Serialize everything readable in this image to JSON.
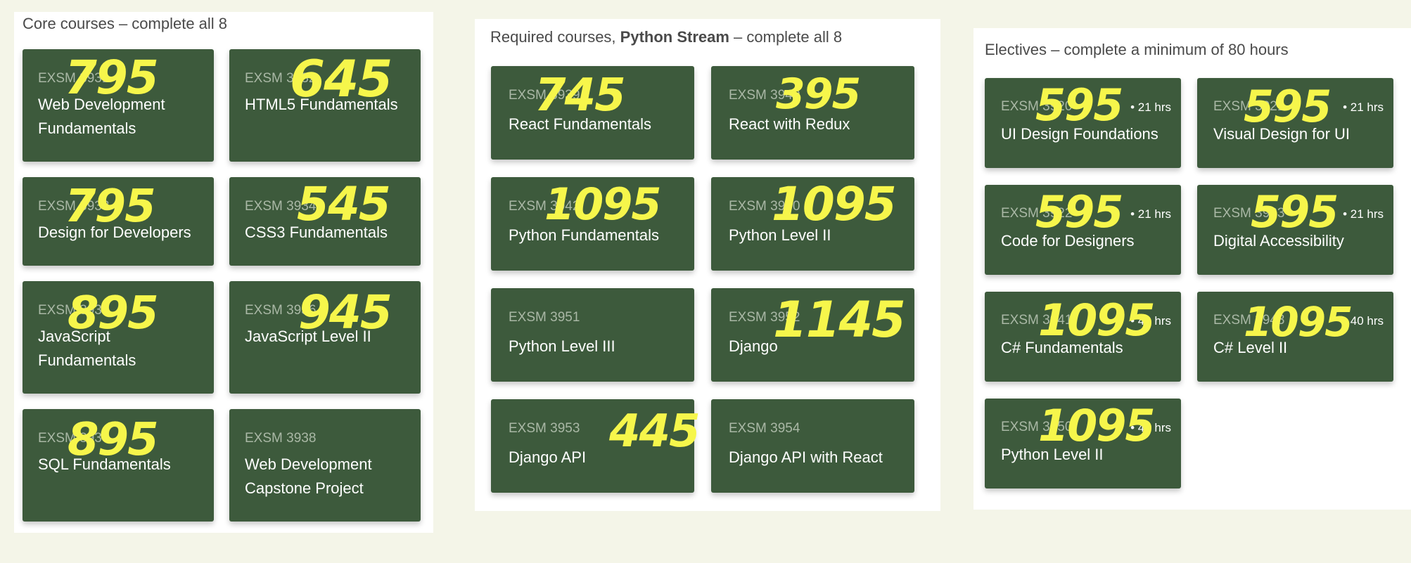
{
  "core": {
    "title": "Core courses – complete all 8",
    "courses": [
      {
        "code": "EXSM 3931",
        "name": "Web Development Fundamentals",
        "price": "795"
      },
      {
        "code": "EXSM 3932",
        "name": "HTML5 Fundamentals",
        "price": "645"
      },
      {
        "code": "EXSM 3933",
        "name": "Design for Developers",
        "price": "795"
      },
      {
        "code": "EXSM 3934",
        "name": "CSS3 Fundamentals",
        "price": "545"
      },
      {
        "code": "EXSM 3935",
        "name": "JavaScript Fundamentals",
        "price": "895"
      },
      {
        "code": "EXSM 3936",
        "name": "JavaScript Level II",
        "price": "945"
      },
      {
        "code": "EXSM 3937",
        "name": "SQL Fundamentals",
        "price": "895"
      },
      {
        "code": "EXSM 3938",
        "name": "Web Development Capstone Project",
        "price": ""
      }
    ]
  },
  "python": {
    "title_prefix": "Required courses, ",
    "title_bold": "Python Stream",
    "title_suffix": " – complete all 8",
    "courses": [
      {
        "code": "EXSM 3939",
        "name": "React Fundamentals",
        "price": "745"
      },
      {
        "code": "EXSM 3940",
        "name": "React with Redux",
        "price": "395"
      },
      {
        "code": "EXSM 3942",
        "name": "Python Fundamentals",
        "price": "1095"
      },
      {
        "code": "EXSM 3950",
        "name": "Python Level II",
        "price": "1095"
      },
      {
        "code": "EXSM 3951",
        "name": "Python Level III",
        "price": ""
      },
      {
        "code": "EXSM 3952",
        "name": "Django",
        "price": "1145"
      },
      {
        "code": "EXSM 3953",
        "name": "Django API",
        "price": "445"
      },
      {
        "code": "EXSM 3954",
        "name": "Django API with React",
        "price": ""
      }
    ]
  },
  "electives": {
    "title": "Electives – complete a minimum of 80 hours",
    "courses": [
      {
        "code": "EXSM 3920",
        "name": "UI Design Foundations",
        "hours": "• 21 hrs",
        "price": "595"
      },
      {
        "code": "EXSM 3921",
        "name": "Visual Design for UI",
        "hours": "• 21 hrs",
        "price": "595"
      },
      {
        "code": "EXSM 3922",
        "name": "Code for Designers",
        "hours": "• 21 hrs",
        "price": "595"
      },
      {
        "code": "EXSM 3923",
        "name": "Digital Accessibility",
        "hours": "• 21 hrs",
        "price": "595"
      },
      {
        "code": "EXSM 3941",
        "name": "C# Fundamentals",
        "hours": "• 40 hrs",
        "price": "1095"
      },
      {
        "code": "EXSM 3943",
        "name": "C# Level II",
        "hours": "• 40 hrs",
        "price": "1095"
      },
      {
        "code": "EXSM 3950",
        "name": "Python Level II",
        "hours": "• 40 hrs",
        "price": "1095"
      }
    ]
  }
}
